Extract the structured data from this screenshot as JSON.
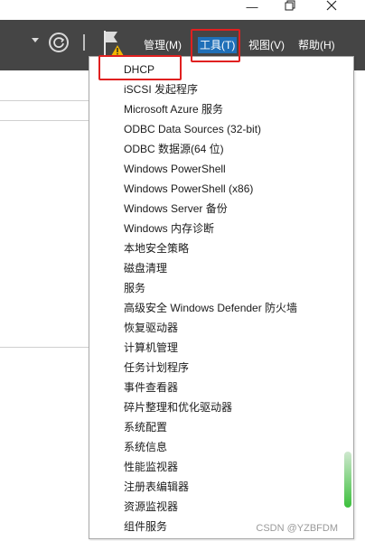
{
  "titlebar": {
    "maximize_icon": "restore-icon",
    "close_icon": "close-icon"
  },
  "toolbar": {
    "icons": [
      "dropdown-arrow-icon",
      "refresh-icon",
      "flag-warning-icon"
    ],
    "menus": [
      {
        "label": "管理(M)",
        "active": false
      },
      {
        "label": "工具(T)",
        "active": true
      },
      {
        "label": "视图(V)",
        "active": false
      },
      {
        "label": "帮助(H)",
        "active": false
      }
    ],
    "active_color": "#1f6fb8",
    "background_color": "#454545"
  },
  "dropdown": {
    "items": [
      "DHCP",
      "iSCSI 发起程序",
      "Microsoft Azure 服务",
      "ODBC Data Sources (32-bit)",
      "ODBC 数据源(64 位)",
      "Windows PowerShell",
      "Windows PowerShell (x86)",
      "Windows Server 备份",
      "Windows 内存诊断",
      "本地安全策略",
      "磁盘清理",
      "服务",
      "高级安全 Windows Defender 防火墙",
      "恢复驱动器",
      "计算机管理",
      "任务计划程序",
      "事件查看器",
      "碎片整理和优化驱动器",
      "系统配置",
      "系统信息",
      "性能监视器",
      "注册表编辑器",
      "资源监视器",
      "组件服务"
    ]
  },
  "highlight_color": "#e02020",
  "watermark": "CSDN @YZBFDM"
}
